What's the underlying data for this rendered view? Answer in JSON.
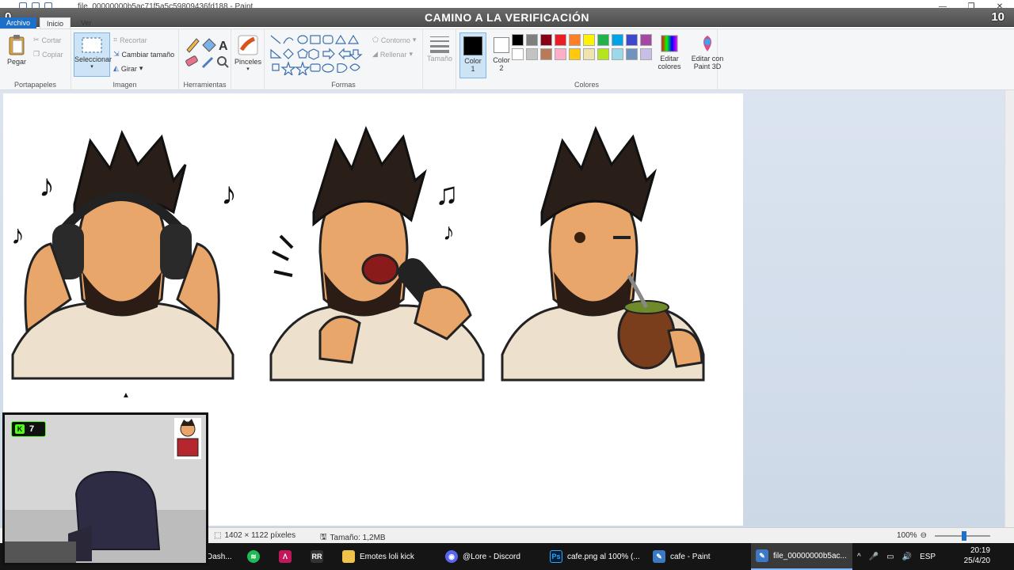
{
  "window": {
    "title": "file_00000000b5ac71f5a5c59809436fd188 - Paint",
    "controls": [
      "—",
      "❐",
      "✕"
    ]
  },
  "overlay": {
    "banner_title": "CAMINO A LA VERIFICACIÓN",
    "left_count": "0",
    "right_count": "10"
  },
  "tabs": [
    {
      "label": "Archivo"
    },
    {
      "label": "Inicio"
    },
    {
      "label": "Ver"
    }
  ],
  "ribbon": {
    "portapapeles": {
      "label": "Portapapeles",
      "pegar": "Pegar",
      "cortar": "Cortar",
      "copiar": "Copiar"
    },
    "imagen": {
      "label": "Imagen",
      "seleccionar": "Seleccionar",
      "recortar": "Recortar",
      "cambiar_tamano": "Cambiar tamaño",
      "girar": "Girar"
    },
    "herramientas": {
      "label": "Herramientas"
    },
    "pinceles": {
      "label": "Pinceles"
    },
    "formas": {
      "label": "Formas",
      "contorno": "Contorno",
      "rellenar": "Rellenar"
    },
    "tamano": {
      "label": "Tamaño"
    },
    "colores": {
      "label": "Colores",
      "color1_line1": "Color",
      "color1_line2": "1",
      "color2_line1": "Color",
      "color2_line2": "2",
      "editar_colores_line1": "Editar",
      "editar_colores_line2": "colores",
      "editar_paint3d_line1": "Editar con",
      "editar_paint3d_line2": "Paint 3D",
      "color1_value": "#000000",
      "color2_value": "#ffffff",
      "palette_row1": [
        "#000000",
        "#7f7f7f",
        "#880015",
        "#ed1c24",
        "#ff7f27",
        "#fff200",
        "#22b14c",
        "#00a2e8",
        "#3f48cc",
        "#a349a4"
      ],
      "palette_row2": [
        "#ffffff",
        "#c3c3c3",
        "#b97a57",
        "#ffaec9",
        "#ffc90e",
        "#efe4b0",
        "#b5e61d",
        "#99d9ea",
        "#7092be",
        "#c8bfe7"
      ]
    }
  },
  "status": {
    "dimensions": "1402 × 1122 píxeles",
    "size": "Tamaño: 1,2MB",
    "zoom": "100%"
  },
  "webcam": {
    "kick_count": "7"
  },
  "taskbar": {
    "items": [
      {
        "label": "Dash...",
        "icon": "dashboard-icon",
        "color": "#2a2a2a"
      },
      {
        "label": "",
        "icon": "spotify-icon",
        "color": "#1db954"
      },
      {
        "label": "",
        "icon": "app-a-icon",
        "color": "#c2185b"
      },
      {
        "label": "",
        "icon": "app-rr-icon",
        "color": "#333333"
      },
      {
        "label": "Emotes loli kick",
        "icon": "folder-icon",
        "color": "#f0c14b"
      },
      {
        "label": "@Lore - Discord",
        "icon": "discord-icon",
        "color": "#5865f2"
      },
      {
        "label": "cafe.png al 100% (...",
        "icon": "photoshop-icon",
        "color": "#001e36"
      },
      {
        "label": "cafe - Paint",
        "icon": "paint-icon",
        "color": "#3b79c4"
      },
      {
        "label": "file_00000000b5ac...",
        "icon": "paint-icon",
        "color": "#3b79c4"
      }
    ],
    "lang": "ESP",
    "time": "20:19",
    "date": "25/4/20"
  }
}
